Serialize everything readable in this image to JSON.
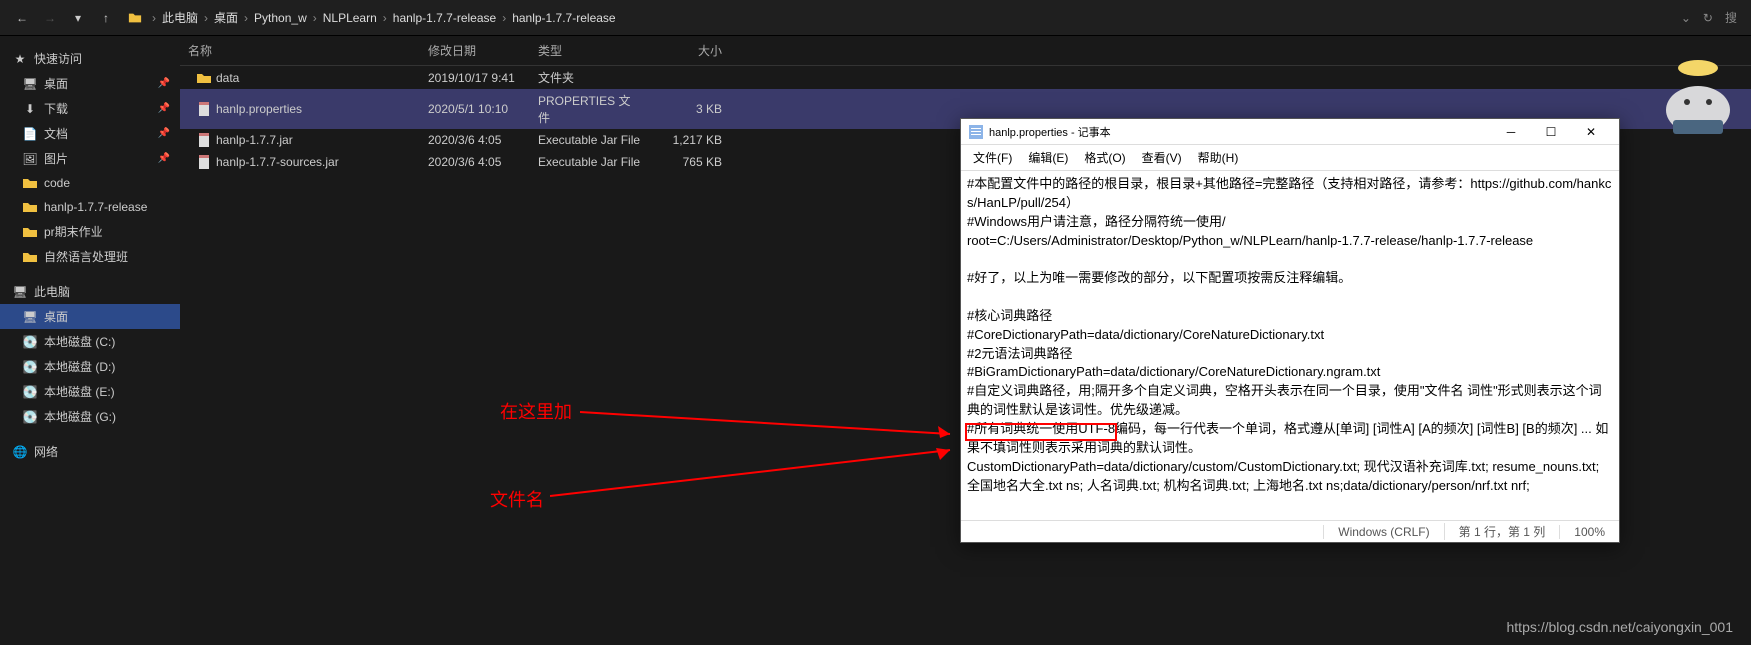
{
  "toolbar": {
    "breadcrumb": [
      "此电脑",
      "桌面",
      "Python_w",
      "NLPLearn",
      "hanlp-1.7.7-release",
      "hanlp-1.7.7-release"
    ],
    "search_placeholder": "搜"
  },
  "sidebar": {
    "quick_access": "快速访问",
    "items_pinned": [
      "桌面",
      "下载",
      "文档",
      "图片",
      "code",
      "hanlp-1.7.7-release",
      "pr期末作业",
      "自然语言处理班"
    ],
    "this_pc": "此电脑",
    "pc_items": [
      "桌面",
      "本地磁盘 (C:)",
      "本地磁盘 (D:)",
      "本地磁盘 (E:)",
      "本地磁盘 (G:)"
    ],
    "network": "网络"
  },
  "columns": {
    "name": "名称",
    "date": "修改日期",
    "type": "类型",
    "size": "大小"
  },
  "files": [
    {
      "name": "data",
      "date": "2019/10/17 9:41",
      "type": "文件夹",
      "size": ""
    },
    {
      "name": "hanlp.properties",
      "date": "2020/5/1 10:10",
      "type": "PROPERTIES 文件",
      "size": "3 KB",
      "sel": true
    },
    {
      "name": "hanlp-1.7.7.jar",
      "date": "2020/3/6 4:05",
      "type": "Executable Jar File",
      "size": "1,217 KB"
    },
    {
      "name": "hanlp-1.7.7-sources.jar",
      "date": "2020/3/6 4:05",
      "type": "Executable Jar File",
      "size": "765 KB"
    }
  ],
  "notepad": {
    "title": "hanlp.properties - 记事本",
    "menu": [
      "文件(F)",
      "编辑(E)",
      "格式(O)",
      "查看(V)",
      "帮助(H)"
    ],
    "body": "#本配置文件中的路径的根目录，根目录+其他路径=完整路径（支持相对路径，请参考：https://github.com/hankcs/HanLP/pull/254）\n#Windows用户请注意，路径分隔符统一使用/\nroot=C:/Users/Administrator/Desktop/Python_w/NLPLearn/hanlp-1.7.7-release/hanlp-1.7.7-release\n\n#好了，以上为唯一需要修改的部分，以下配置项按需反注释编辑。\n\n#核心词典路径\n#CoreDictionaryPath=data/dictionary/CoreNatureDictionary.txt\n#2元语法词典路径\n#BiGramDictionaryPath=data/dictionary/CoreNatureDictionary.ngram.txt\n#自定义词典路径，用;隔开多个自定义词典，空格开头表示在同一个目录，使用\"文件名 词性\"形式则表示这个词典的词性默认是该词性。优先级递减。\n#所有词典统一使用UTF-8编码，每一行代表一个单词，格式遵从[单词] [词性A] [A的频次] [词性B] [B的频次] ... 如果不填词性则表示采用词典的默认词性。\nCustomDictionaryPath=data/dictionary/custom/CustomDictionary.txt; 现代汉语补充词库.txt; resume_nouns.txt; 全国地名大全.txt ns; 人名词典.txt; 机构名词典.txt; 上海地名.txt ns;data/dictionary/person/nrf.txt nrf;",
    "status": {
      "encoding": "Windows (CRLF)",
      "pos": "第 1 行，第 1 列",
      "zoom": "100%"
    }
  },
  "annotations": {
    "label1": "在这里加",
    "label2": "文件名"
  },
  "watermark": "https://blog.csdn.net/caiyongxin_001"
}
